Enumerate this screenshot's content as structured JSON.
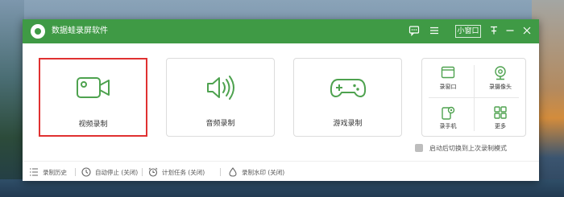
{
  "app": {
    "title": "数据蛙录屏软件"
  },
  "titlebar": {
    "mini_window_label": "小窗口"
  },
  "main": {
    "cards": [
      {
        "label": "视频录制",
        "icon": "video-camera-icon",
        "selected": true
      },
      {
        "label": "音频录制",
        "icon": "speaker-icon",
        "selected": false
      },
      {
        "label": "游戏录制",
        "icon": "gamepad-icon",
        "selected": false
      }
    ]
  },
  "tools": [
    {
      "label": "录窗口",
      "icon": "window-icon"
    },
    {
      "label": "录摄像头",
      "icon": "webcam-icon"
    },
    {
      "label": "录手机",
      "icon": "phone-icon"
    },
    {
      "label": "更多",
      "icon": "more-grid-icon"
    }
  ],
  "auto_switch": {
    "label": "启动后切换到上次录制模式",
    "checked": false
  },
  "footer": [
    {
      "label": "录制历史",
      "icon": "list-icon"
    },
    {
      "label": "自动停止 (关闭)",
      "icon": "clock-icon"
    },
    {
      "label": "计划任务 (关闭)",
      "icon": "alarm-icon"
    },
    {
      "label": "录制水印 (关闭)",
      "icon": "drop-icon"
    }
  ],
  "colors": {
    "brand": "#3f9a45",
    "selected_border": "#e03131",
    "icon_green": "#4ea24f"
  }
}
